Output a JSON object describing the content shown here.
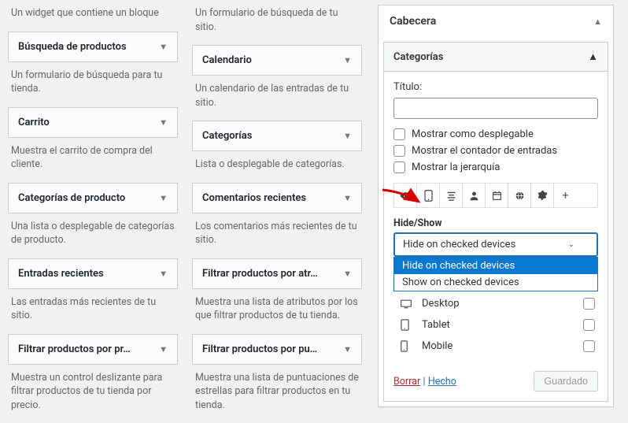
{
  "left": {
    "intro": [
      "Un widget que contiene un bloque",
      "Un formulario de búsqueda de tu sitio."
    ],
    "col1": [
      {
        "title": "Búsqueda de productos",
        "desc": "Un formulario de búsqueda para tu tienda."
      },
      {
        "title": "Carrito",
        "desc": "Muestra el carrito de compra del cliente."
      },
      {
        "title": "Categorías de producto",
        "desc": "Una lista o desplegable de categorías de producto."
      },
      {
        "title": "Entradas recientes",
        "desc": "Las entradas más recientes de tu sitio."
      },
      {
        "title": "Filtrar productos por pr…",
        "desc": "Muestra un control deslizante para filtrar productos de tu tienda por precio."
      }
    ],
    "col2": [
      {
        "title": "Calendario",
        "desc": "Un calendario de las entradas de tu sitio."
      },
      {
        "title": "Categorías",
        "desc": "Lista o desplegable de categorías."
      },
      {
        "title": "Comentarios recientes",
        "desc": "Los comentarios más recientes de tu sitio."
      },
      {
        "title": "Filtrar productos por atr…",
        "desc": "Muestra una lista de atributos por los que filtrar productos de tu tienda."
      },
      {
        "title": "Filtrar productos por pu…",
        "desc": "Muestra una lista de puntuaciones de estrellas para filtrar productos en tu tienda."
      }
    ]
  },
  "right": {
    "title": "Cabecera",
    "sub_title": "Categorías",
    "title_label": "Título:",
    "checks": [
      "Mostrar como desplegable",
      "Mostrar el contador de entradas",
      "Mostrar la jerarquía"
    ],
    "hideshow_label": "Hide/Show",
    "select_value": "Hide on checked devices",
    "options": [
      "Hide on checked devices",
      "Show on checked devices"
    ],
    "devices": [
      {
        "icon": "⬚",
        "name": "Desktop"
      },
      {
        "icon": "▢",
        "name": "Tablet"
      },
      {
        "icon": "▯",
        "name": "Mobile"
      }
    ],
    "delete": "Borrar",
    "done": "Hecho",
    "saved": "Guardado"
  }
}
